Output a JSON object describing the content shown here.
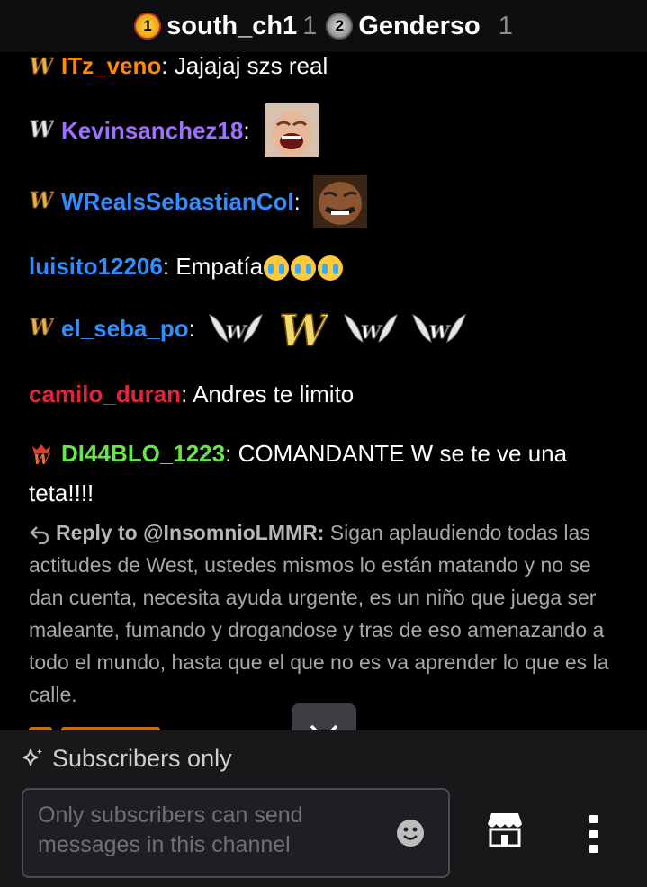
{
  "leaderboard": [
    {
      "rank": "1",
      "name": "south_ch1",
      "count": "1"
    },
    {
      "rank": "2",
      "name": "Genderso",
      "count": "1"
    }
  ],
  "messages": [
    {
      "user": "ITz_veno",
      "color": "#ff8a00",
      "text": "Jajajaj szs real",
      "badge": "w-gold-icon"
    },
    {
      "user": "Kevinsanchez18",
      "color": "#9f6fff",
      "text": "",
      "badge": "w-silver-icon"
    },
    {
      "user": "WRealsSebastianCol",
      "color": "#2f8dff",
      "text": "",
      "badge": "w-gold-icon"
    },
    {
      "user": "luisito12206",
      "color": "#2f8dff",
      "text": "Empatía",
      "badge": ""
    },
    {
      "user": "el_seba_po",
      "color": "#2f8dff",
      "text": "",
      "badge": "w-gold-icon"
    },
    {
      "user": "camilo_duran",
      "color": "#e2243a",
      "text": "Andres te limito",
      "badge": ""
    },
    {
      "user": "DI44BLO_1223",
      "color": "#68e54a",
      "text": "COMANDANTE W se te ve una teta!!!!",
      "badge": "w-red-icon"
    }
  ],
  "reply": {
    "prefix": "Reply to @InsomnioLMMR:",
    "text": "Sigan aplaudiendo todas las actitudes de West, ustedes mismos lo están matando y no se dan cuenta, necesita ayuda urgente, es un niño que juega ser maleante, fumando y drogandose y tras de eso amenazando a todo el mundo, hasta que",
    "text2": "el que no es va aprender lo que es la calle."
  },
  "composer": {
    "mode": "Subscribers only",
    "placeholder": "Only subscribers can send messages in this channel"
  },
  "colors": {
    "accent": "#9f6fff",
    "background": "#000000",
    "composer_bg": "#18181b"
  }
}
